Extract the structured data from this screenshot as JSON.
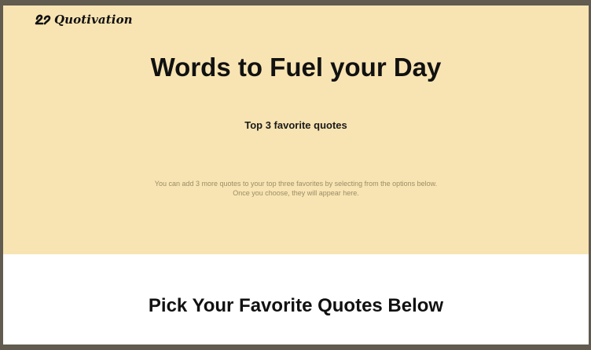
{
  "brand": {
    "name": "Quotivation",
    "logo_icon": "quotation-mark-icon"
  },
  "hero": {
    "title": "Words to Fuel your Day",
    "subtitle": "Top 3 favorite quotes",
    "note_line1": "You can add 3 more quotes to your top three favorites by selecting from the options below.",
    "note_line2": "Once you choose, they will appear here."
  },
  "picker": {
    "title": "Pick Your Favorite Quotes Below"
  },
  "colors": {
    "hero_background": "#f8e4b2",
    "page_background": "#ffffff",
    "frame_background": "#615b50",
    "note_text": "#9b8d67"
  }
}
